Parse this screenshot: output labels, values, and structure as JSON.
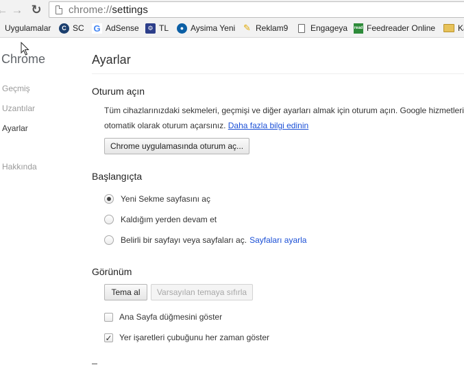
{
  "toolbar": {
    "back_icon": "arrow-left-icon",
    "forward_icon": "arrow-right-icon",
    "reload_icon": "reload-icon",
    "url_scheme": "chrome://",
    "url_path": "settings"
  },
  "bookmarks": [
    {
      "label": "Uygulamalar",
      "icon": "apps-icon"
    },
    {
      "label": "SC",
      "icon": "sc-icon",
      "glyph": "C"
    },
    {
      "label": "AdSense",
      "icon": "google-icon",
      "glyph": "G"
    },
    {
      "label": "TL",
      "icon": "tl-icon",
      "glyph": "⚙"
    },
    {
      "label": "Aysima Yeni",
      "icon": "aysima-icon",
      "glyph": "●"
    },
    {
      "label": "Reklam9",
      "icon": "reklam9-icon",
      "glyph": "✎"
    },
    {
      "label": "Engageya",
      "icon": "page-icon"
    },
    {
      "label": "Feedreader Online",
      "icon": "feedreader-icon",
      "glyph": "read"
    },
    {
      "label": "Ka",
      "icon": "folder-icon"
    }
  ],
  "sidebar": {
    "title": "Chrome",
    "items": [
      {
        "label": "Geçmiş",
        "active": false
      },
      {
        "label": "Uzantılar",
        "active": false
      },
      {
        "label": "Ayarlar",
        "active": true
      },
      {
        "label": "Hakkında",
        "active": false
      }
    ]
  },
  "main": {
    "title": "Ayarlar",
    "signin": {
      "heading": "Oturum açın",
      "text_line1": "Tüm cihazlarınızdaki sekmeleri, geçmişi ve diğer ayarları almak için oturum açın. Google hizmetlerine",
      "text_line2": "otomatik olarak oturum açarsınız.",
      "link": "Daha fazla bilgi edinin",
      "button": "Chrome uygulamasında oturum aç..."
    },
    "startup": {
      "heading": "Başlangıçta",
      "options": [
        {
          "label": "Yeni Sekme sayfasını aç",
          "checked": true
        },
        {
          "label": "Kaldığım yerden devam et",
          "checked": false
        },
        {
          "label": "Belirli bir sayfayı veya sayfaları aç.",
          "checked": false,
          "link": "Sayfaları ayarla"
        }
      ]
    },
    "appearance": {
      "heading": "Görünüm",
      "theme_button": "Tema al",
      "reset_button": "Varsayılan temaya sıfırla",
      "checkboxes": [
        {
          "label": "Ana Sayfa düğmesini göster",
          "checked": false
        },
        {
          "label": "Yer işaretleri çubuğunu her zaman göster",
          "checked": true
        }
      ]
    }
  }
}
